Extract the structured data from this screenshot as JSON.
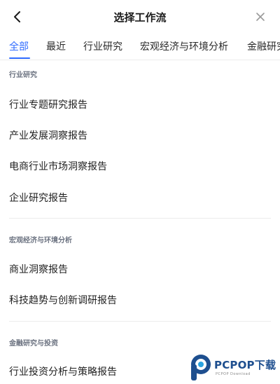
{
  "header": {
    "title": "选择工作流",
    "back_icon": "chevron-left-icon",
    "close_icon": "close-icon"
  },
  "tabs": [
    {
      "label": "全部",
      "active": true
    },
    {
      "label": "最近",
      "active": false
    },
    {
      "label": "行业研究",
      "active": false
    },
    {
      "label": "宏观经济与环境分析",
      "active": false
    },
    {
      "label": "金融研究",
      "active": false
    }
  ],
  "sections": [
    {
      "title": "行业研究",
      "items": [
        "行业专题研究报告",
        "产业发展洞察报告",
        "电商行业市场洞察报告",
        "企业研究报告"
      ]
    },
    {
      "title": "宏观经济与环境分析",
      "items": [
        "商业洞察报告",
        "科技趋势与创新调研报告"
      ]
    },
    {
      "title": "金融研究与投资",
      "items": [
        "行业投资分析与策略报告"
      ]
    }
  ],
  "watermark": {
    "text": "PCPOP下载",
    "sub": "PCPOP Download"
  },
  "colors": {
    "accent": "#2f6bff",
    "section_title": "#6b7280",
    "divider": "#ececec",
    "watermark": "#1e4f8f"
  }
}
